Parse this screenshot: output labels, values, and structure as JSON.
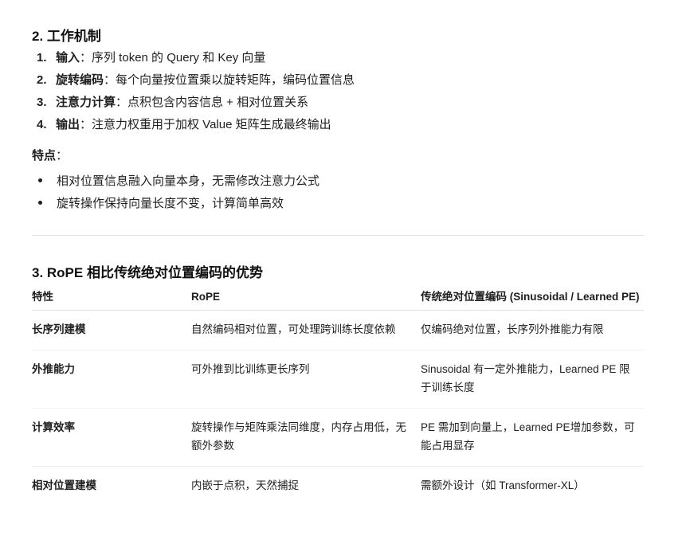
{
  "section2": {
    "title": "2. 工作机制",
    "steps": [
      {
        "num": "1.",
        "term": "输入",
        "text": "：序列 token 的 Query 和 Key 向量"
      },
      {
        "num": "2.",
        "term": "旋转编码",
        "text": "：每个向量按位置乘以旋转矩阵，编码位置信息"
      },
      {
        "num": "3.",
        "term": "注意力计算",
        "text": "：点积包含内容信息 + 相对位置关系"
      },
      {
        "num": "4.",
        "term": "输出",
        "text": "：注意力权重用于加权 Value 矩阵生成最终输出"
      }
    ],
    "features_label": "特点",
    "features_colon": "：",
    "features": [
      "相对位置信息融入向量本身，无需修改注意力公式",
      "旋转操作保持向量长度不变，计算简单高效"
    ]
  },
  "section3": {
    "title": "3. RoPE 相比传统绝对位置编码的优势",
    "table": {
      "headers": [
        "特性",
        "RoPE",
        "传统绝对位置编码 (Sinusoidal / Learned PE)"
      ],
      "rows": [
        [
          "长序列建模",
          "自然编码相对位置，可处理跨训练长度依赖",
          "仅编码绝对位置，长序列外推能力有限"
        ],
        [
          "外推能力",
          "可外推到比训练更长序列",
          "Sinusoidal 有一定外推能力，Learned PE 限于训练长度"
        ],
        [
          "计算效率",
          "旋转操作与矩阵乘法同维度，内存占用低，无额外参数",
          "PE 需加到向量上，Learned PE增加参数，可能占用显存"
        ],
        [
          "相对位置建模",
          "内嵌于点积，天然捕捉",
          "需额外设计（如 Transformer-XL）"
        ]
      ]
    }
  }
}
